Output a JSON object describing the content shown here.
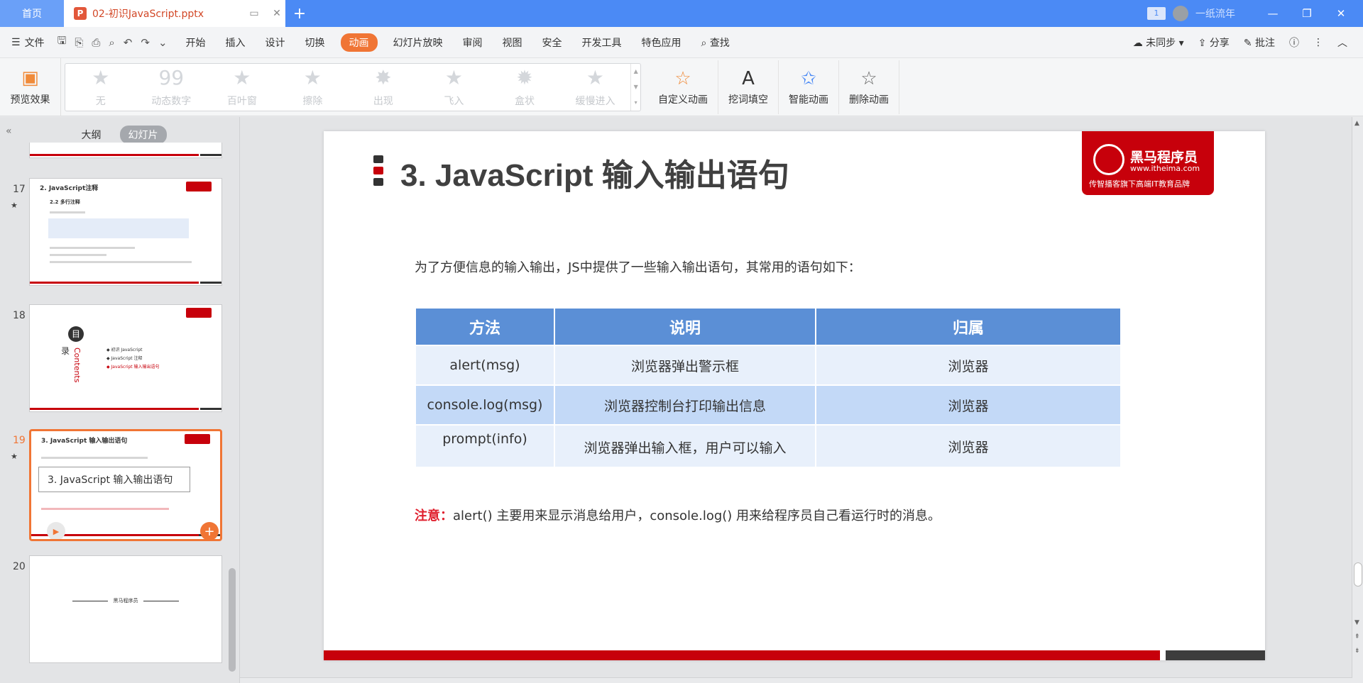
{
  "tabs": {
    "home": "首页",
    "doc": "02-初识JavaScript.pptx",
    "page_count": "1",
    "user": "一纸流年"
  },
  "menu": {
    "file": "文件",
    "items": [
      "开始",
      "插入",
      "设计",
      "切换",
      "动画",
      "幻灯片放映",
      "审阅",
      "视图",
      "安全",
      "开发工具",
      "特色应用"
    ],
    "active": "动画",
    "search": "查找",
    "sync": "未同步",
    "share": "分享",
    "comment": "批注"
  },
  "ribbon": {
    "preview": "预览效果",
    "gallery": [
      "无",
      "动态数字",
      "百叶窗",
      "擦除",
      "出现",
      "飞入",
      "盒状",
      "缓慢进入"
    ],
    "custom": "自定义动画",
    "fill_blank": "挖词填空",
    "smart": "智能动画",
    "delete": "删除动画"
  },
  "panel": {
    "outline": "大纲",
    "slides": "幻灯片",
    "thumbs": [
      {
        "num": "17",
        "title": "2. JavaScript注释",
        "sub": "2.2 多行注释"
      },
      {
        "num": "18",
        "toc_icon": "目",
        "toc_char": "录",
        "toc_en": "Contents",
        "items": [
          "初识 JavaScript",
          "JavaScript 注释",
          "JavaScript 输入输出语句"
        ]
      },
      {
        "num": "19",
        "title": "3. JavaScript 输入输出语句",
        "tooltip": "3. JavaScript 输入输出语句"
      },
      {
        "num": "20",
        "logo": "黑马程序员"
      }
    ]
  },
  "slide": {
    "title": "3. JavaScript 输入输出语句",
    "brand_name": "黑马程序员",
    "brand_url": "www.itheima.com",
    "brand_slogan": "传智播客旗下高端IT教育品牌",
    "intro": "为了方便信息的输入输出，JS中提供了一些输入输出语句，其常用的语句如下：",
    "table": {
      "headers": [
        "方法",
        "说明",
        "归属"
      ],
      "rows": [
        [
          "alert(msg)",
          "浏览器弹出警示框",
          "浏览器"
        ],
        [
          "console.log(msg)",
          "浏览器控制台打印输出信息",
          "浏览器"
        ],
        [
          "prompt(info)",
          "浏览器弹出输入框，用户可以输入",
          "浏览器"
        ]
      ]
    },
    "note_label": "注意：",
    "note_text": "alert() 主要用来显示消息给用户，console.log() 用来给程序员自己看运行时的消息。"
  },
  "colors": {
    "accent": "#f07535",
    "brand_red": "#c7000b",
    "table_header": "#5b8fd6"
  }
}
